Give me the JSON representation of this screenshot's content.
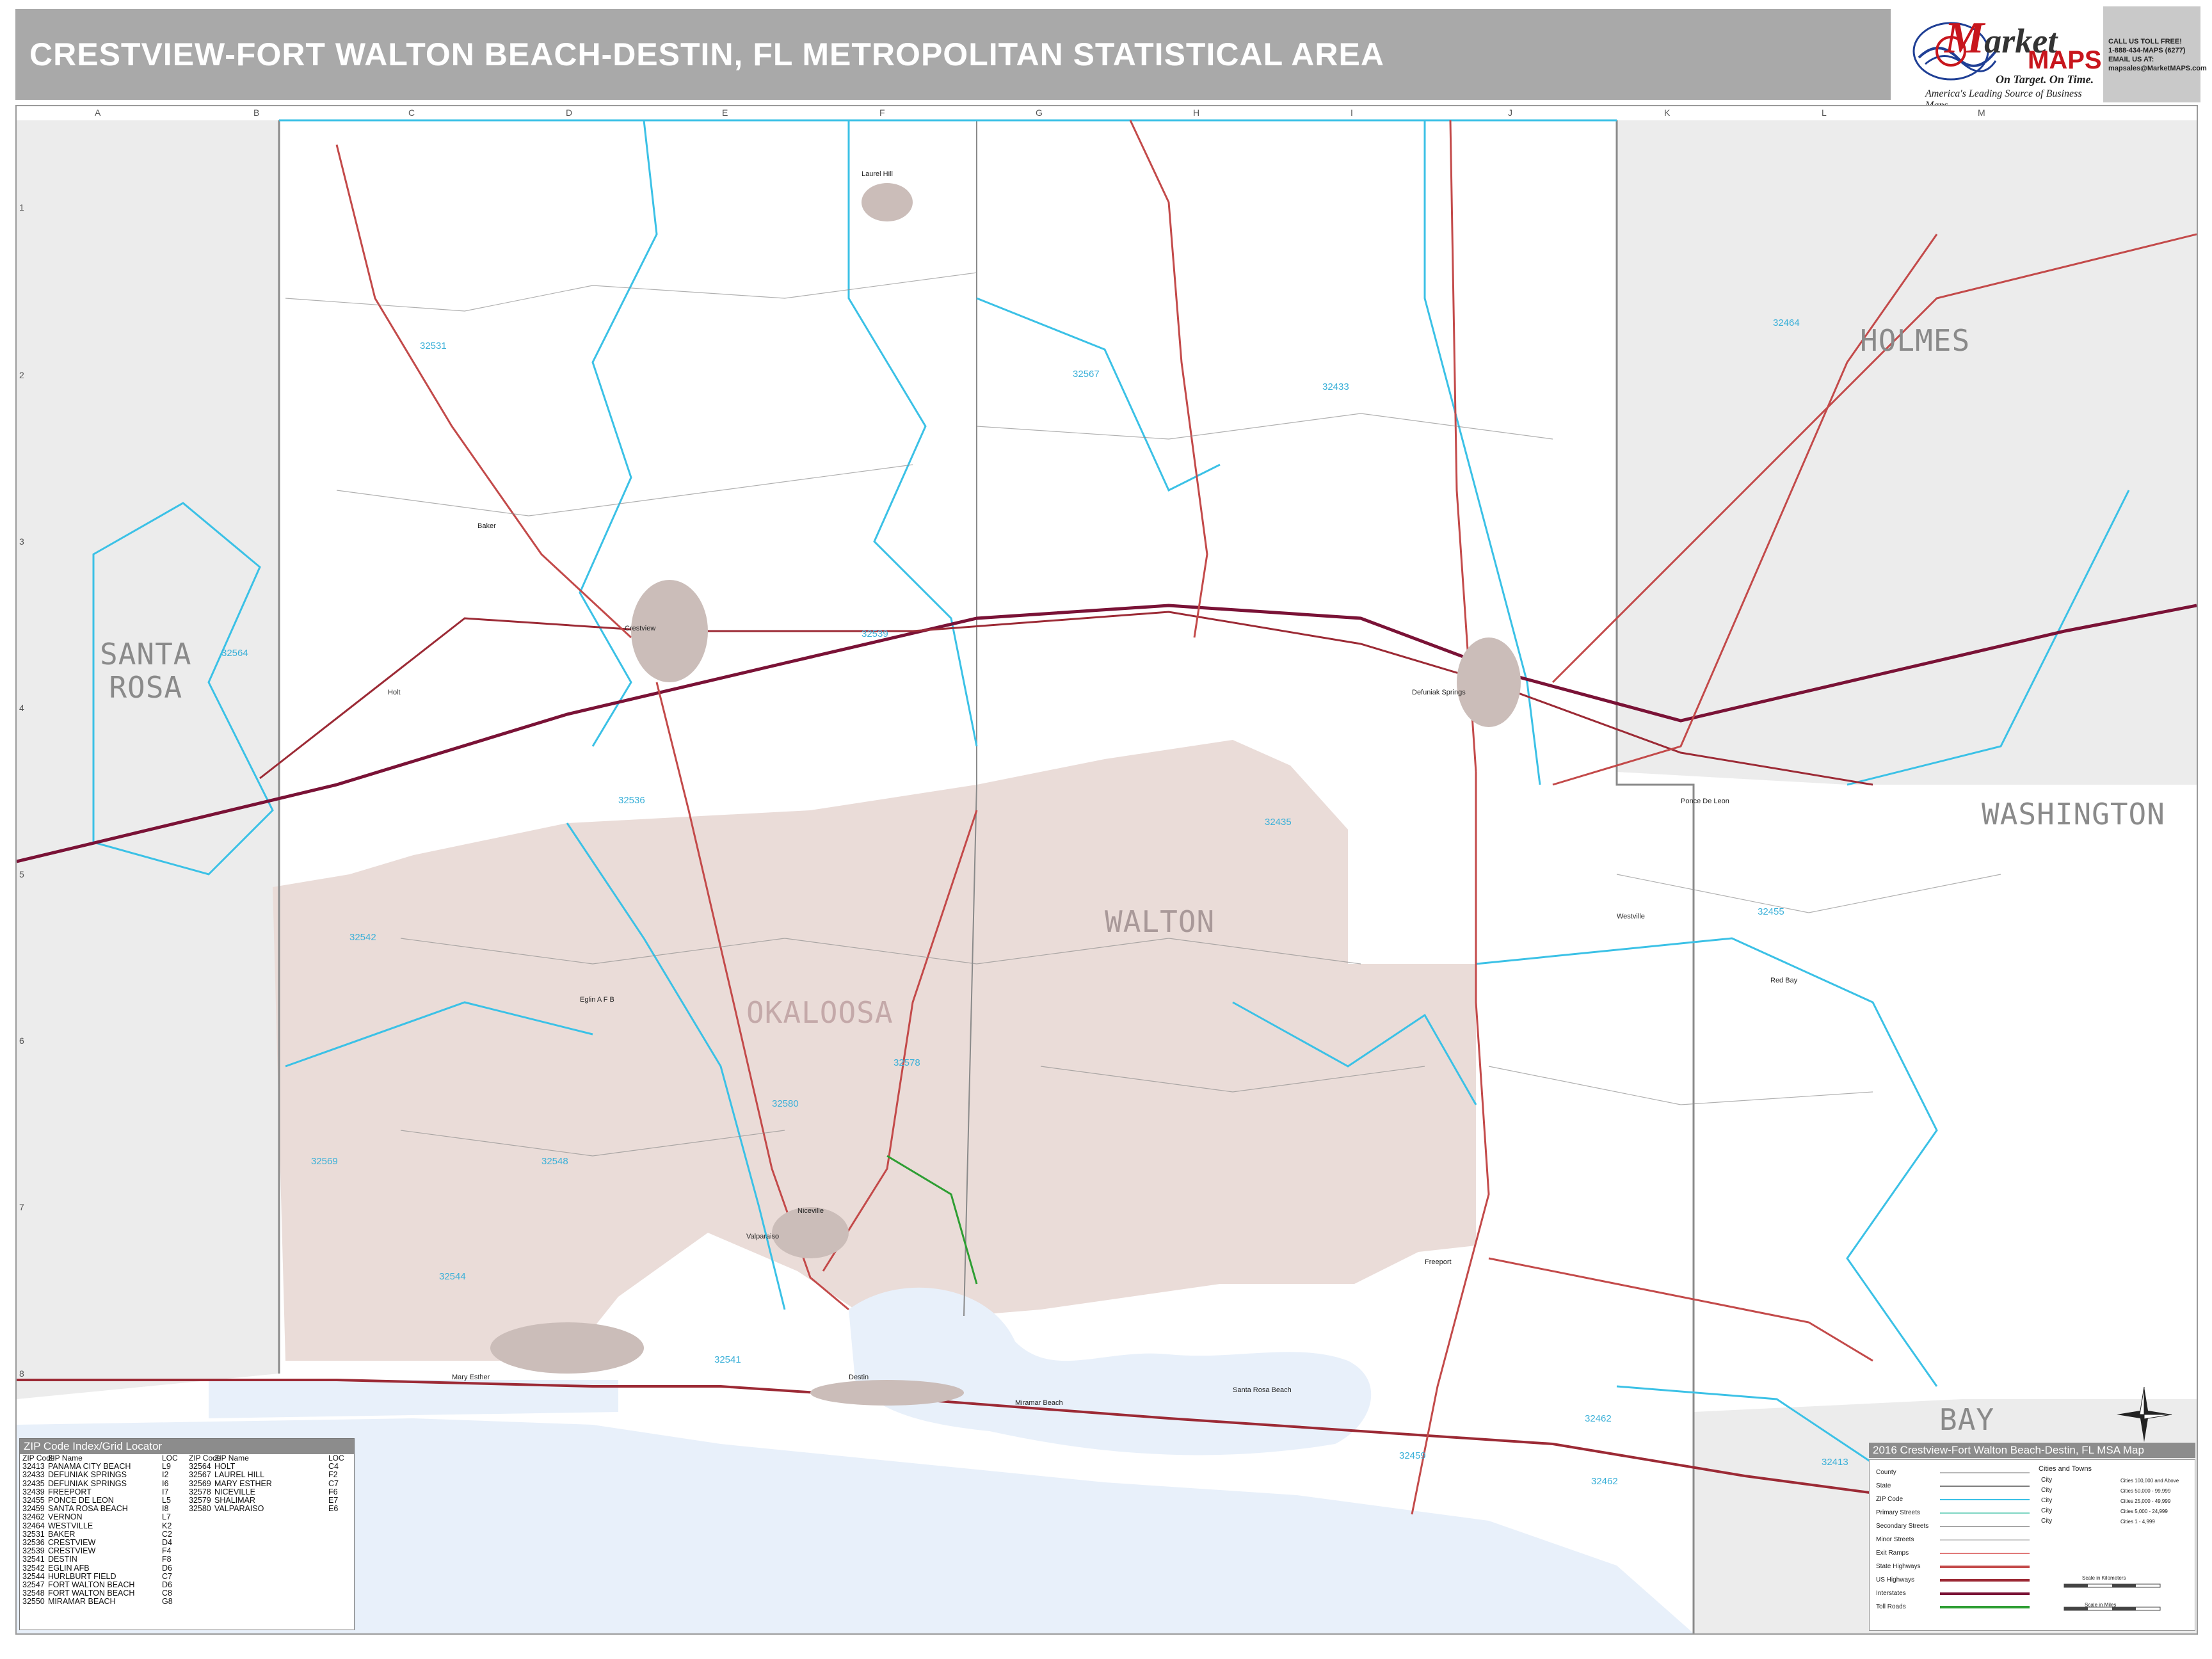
{
  "header": {
    "title": "CRESTVIEW-FORT WALTON BEACH-DESTIN, FL METROPOLITAN STATISTICAL AREA"
  },
  "brand": {
    "name_prefix": "M",
    "name_rest": "arket",
    "maps": "MAPS",
    "slogan": "On Target. On Time.",
    "tagline": "America's Leading Source of Business Maps",
    "contact": [
      "CALL US TOLL FREE!",
      "1-888-434-MAPS (6277)",
      "",
      "EMAIL US AT:",
      "mapsales@MarketMAPS.com"
    ]
  },
  "grid": {
    "letters": [
      "A",
      "B",
      "C",
      "D",
      "E",
      "F",
      "G",
      "H",
      "I",
      "J",
      "K",
      "L",
      "M"
    ],
    "numbers": [
      "1",
      "2",
      "3",
      "4",
      "5",
      "6",
      "7",
      "8"
    ]
  },
  "counties": {
    "santa_rosa": [
      "SANTA",
      "ROSA"
    ],
    "holmes": "HOLMES",
    "washington": "WASHINGTON",
    "walton": "WALTON",
    "okaloosa": "OKALOOSA",
    "bay": "BAY"
  },
  "zip_labels": [
    "32531",
    "32567",
    "32433",
    "32464",
    "32564",
    "32539",
    "32536",
    "32435",
    "32542",
    "32455",
    "32578",
    "32580",
    "32569",
    "32544",
    "32548",
    "32541",
    "32459",
    "32462",
    "32413",
    "32413",
    "32462"
  ],
  "place_labels": [
    "Laurel Hill",
    "Crestview",
    "Baker",
    "Holt",
    "Defuniak Springs",
    "Niceville",
    "Valparaiso",
    "Destin",
    "Santa Rosa Beach",
    "Freeport",
    "Mary Esther",
    "Eglin A F B",
    "Ponce De Leon",
    "Westville",
    "Red Bay",
    "Miramar Beach"
  ],
  "zip_index": {
    "title": "ZIP Code Index/Grid Locator",
    "headers": [
      "ZIP Code",
      "ZIP Name",
      "LOC"
    ],
    "left": [
      [
        "32413",
        "PANAMA CITY BEACH",
        "L9"
      ],
      [
        "32433",
        "DEFUNIAK SPRINGS",
        "I2"
      ],
      [
        "32435",
        "DEFUNIAK SPRINGS",
        "I6"
      ],
      [
        "32439",
        "FREEPORT",
        "I7"
      ],
      [
        "32455",
        "PONCE DE LEON",
        "L5"
      ],
      [
        "32459",
        "SANTA ROSA BEACH",
        "I8"
      ],
      [
        "32462",
        "VERNON",
        "L7"
      ],
      [
        "32464",
        "WESTVILLE",
        "K2"
      ],
      [
        "32531",
        "BAKER",
        "C2"
      ],
      [
        "32536",
        "CRESTVIEW",
        "D4"
      ],
      [
        "32539",
        "CRESTVIEW",
        "F4"
      ],
      [
        "32541",
        "DESTIN",
        "F8"
      ],
      [
        "32542",
        "EGLIN AFB",
        "D6"
      ],
      [
        "32544",
        "HURLBURT FIELD",
        "C7"
      ],
      [
        "32547",
        "FORT WALTON BEACH",
        "D6"
      ],
      [
        "32548",
        "FORT WALTON BEACH",
        "C8"
      ],
      [
        "32550",
        "MIRAMAR BEACH",
        "G8"
      ]
    ],
    "right": [
      [
        "32564",
        "HOLT",
        "C4"
      ],
      [
        "32567",
        "LAUREL HILL",
        "F2"
      ],
      [
        "32569",
        "MARY ESTHER",
        "C7"
      ],
      [
        "32578",
        "NICEVILLE",
        "F6"
      ],
      [
        "32579",
        "SHALIMAR",
        "E7"
      ],
      [
        "32580",
        "VALPARAISO",
        "E6"
      ]
    ]
  },
  "legend": {
    "title": "2016 Crestview-Fort Walton Beach-Destin, FL MSA Map",
    "cities_head": "Cities and Towns",
    "rows": [
      {
        "label": "County",
        "color": "#b9b9b9"
      },
      {
        "label": "State",
        "color": "#7d7d7d"
      },
      {
        "label": "ZIP Code",
        "color": "#3bc1e6"
      },
      {
        "label": "Primary Streets",
        "color": "#7fd6c4"
      },
      {
        "label": "Secondary Streets",
        "color": "#a8a8a8"
      },
      {
        "label": "Minor Streets",
        "color": "#cccccc"
      },
      {
        "label": "Exit Ramps",
        "color": "#e07a7a"
      },
      {
        "label": "State Highways",
        "color": "#c34a4a"
      },
      {
        "label": "US Highways",
        "color": "#9c2a35"
      },
      {
        "label": "Interstates",
        "color": "#7a1236"
      },
      {
        "label": "Toll Roads",
        "color": "#2e9e33"
      }
    ],
    "city_sizes": [
      {
        "word": "City",
        "desc": "Cities 100,000 and Above"
      },
      {
        "word": "City",
        "desc": "Cities 50,000 - 99,999"
      },
      {
        "word": "City",
        "desc": "Cities 25,000 - 49,999"
      },
      {
        "word": "City",
        "desc": "Cities 5,000 - 24,999"
      },
      {
        "word": "City",
        "desc": "Cities 1 - 4,999"
      }
    ],
    "scale_km": "Scale in Kilometers",
    "scale_mi": "Scale in Miles"
  },
  "colors": {
    "military_land": "#eadcd8",
    "neighbor_county": "#ececec",
    "water": "#e8f0fa",
    "zip_boundary": "#3bc1e6",
    "interstate": "#7a1236",
    "state_highway": "#c34a4a",
    "county_boundary": "#8a8a8a"
  }
}
